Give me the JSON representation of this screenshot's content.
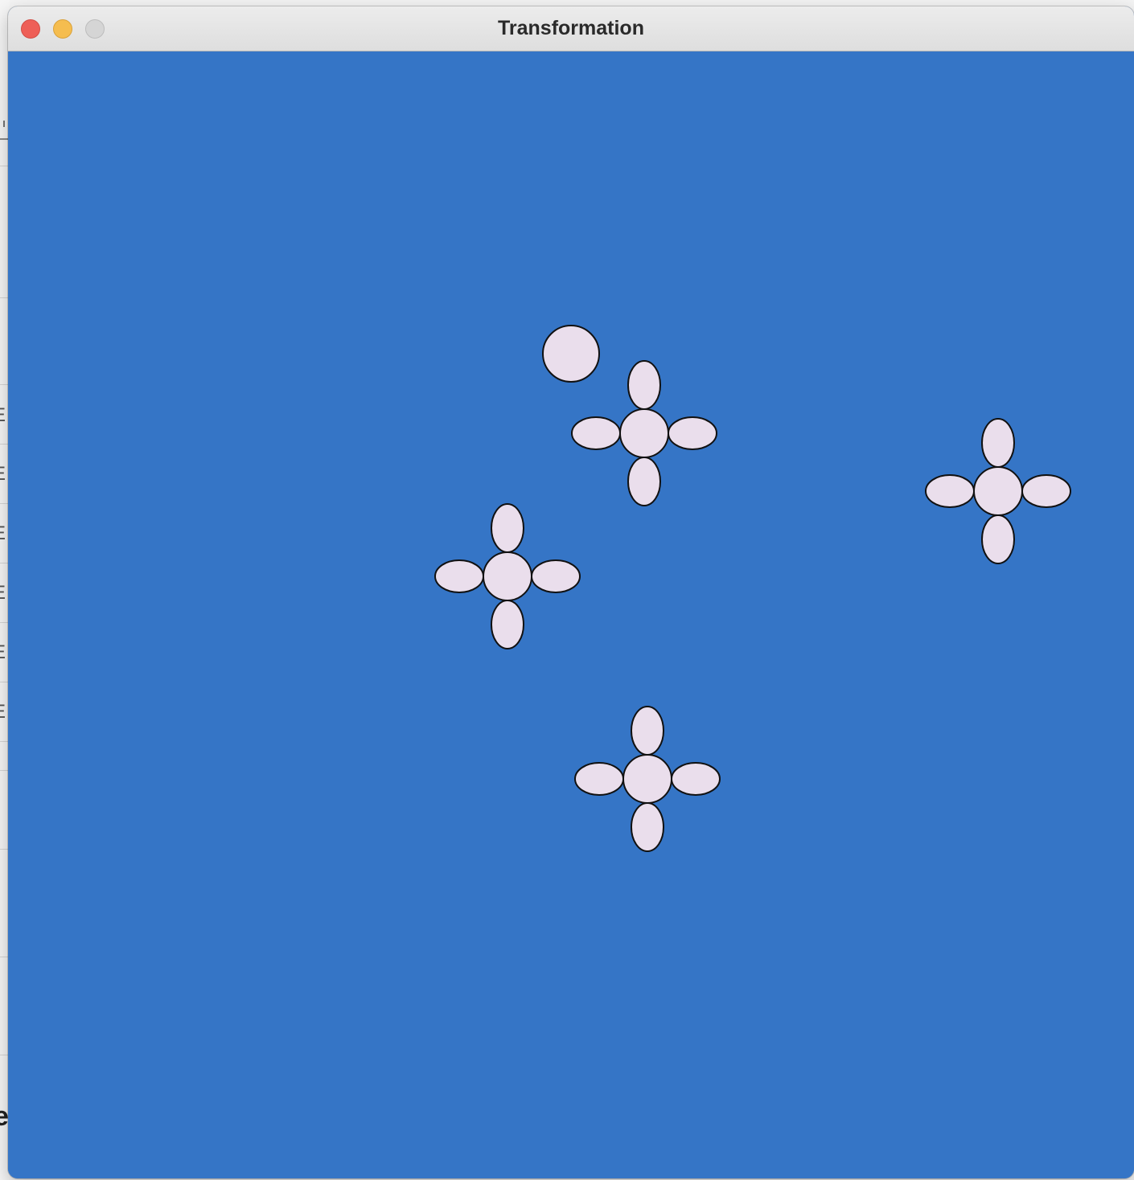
{
  "window": {
    "title": "Transformation"
  },
  "colors": {
    "canvas_background": "#3575c6",
    "shape_fill": "#eadeec",
    "shape_stroke": "#111111"
  },
  "background_app": {
    "fragments": [
      "E",
      "E",
      "E",
      "E",
      "E",
      "E"
    ],
    "big_fragment": "e"
  },
  "canvas": {
    "shapes": [
      "circle",
      "flower",
      "flower",
      "flower",
      "flower"
    ]
  }
}
